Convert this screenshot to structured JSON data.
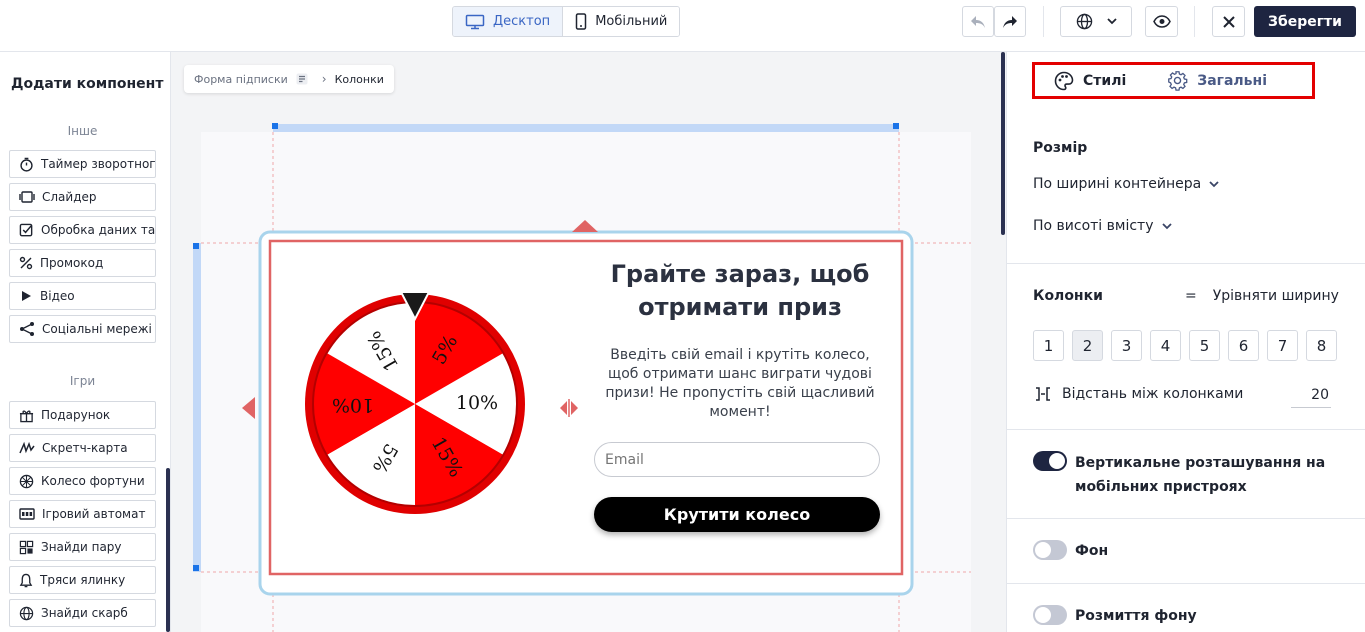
{
  "topbar": {
    "desktop_label": "Десктоп",
    "mobile_label": "Мобільний",
    "save_label": "Зберегти"
  },
  "sidebar": {
    "title": "Додати компонент",
    "section_other": "Інше",
    "other_items": [
      {
        "label": "Таймер зворотного відліку",
        "icon": "timer-icon"
      },
      {
        "label": "Слайдер",
        "icon": "slider-icon"
      },
      {
        "label": "Обробка даних та згода",
        "icon": "checkbox-icon"
      },
      {
        "label": "Промокод",
        "icon": "percent-icon"
      },
      {
        "label": "Відео",
        "icon": "play-icon"
      },
      {
        "label": "Соціальні мережі",
        "icon": "share-icon"
      }
    ],
    "section_games": "Ігри",
    "game_items": [
      {
        "label": "Подарунок",
        "icon": "gift-icon"
      },
      {
        "label": "Скретч-карта",
        "icon": "scratch-icon"
      },
      {
        "label": "Колесо фортуни",
        "icon": "wheel-icon"
      },
      {
        "label": "Ігровий автомат",
        "icon": "slot-machine-icon"
      },
      {
        "label": "Знайди пару",
        "icon": "grid-icon"
      },
      {
        "label": "Тряси ялинку",
        "icon": "bell-icon"
      },
      {
        "label": "Знайди скарб",
        "icon": "globe-icon"
      }
    ]
  },
  "breadcrumb": {
    "parent": "Форма підписки",
    "current": "Колонки"
  },
  "popup": {
    "title": "Грайте зараз, щоб отримати приз",
    "description": "Введіть свій email і крутіть колесо, щоб отримати шанс виграти чудові призи! Не пропустіть свій щасливий момент!",
    "email_placeholder": "Email",
    "cta_label": "Крутити колесо",
    "wheel_segments": [
      "5%",
      "10%",
      "15%",
      "5%",
      "10%",
      "15%"
    ]
  },
  "panel": {
    "tab_styles": "Стилі",
    "tab_general": "Загальні",
    "size_title": "Розмір",
    "width_select": "По ширині контейнера",
    "height_select": "По висоті вмісту",
    "columns_title": "Колонки",
    "columns_align": "Урівняти ширину",
    "column_numbers": [
      "1",
      "2",
      "3",
      "4",
      "5",
      "6",
      "7",
      "8"
    ],
    "selected_columns": "2",
    "gap_label": "Відстань між колонками",
    "gap_value": "20",
    "vertical_label": "Вертикальне розташування на мобільних пристроях",
    "background_label": "Фон",
    "blur_label": "Розмиття фону"
  },
  "colors": {
    "accent_red": "#ff0000",
    "dark_navy": "#1e2541",
    "selection_blue": "#a8c8ff"
  }
}
